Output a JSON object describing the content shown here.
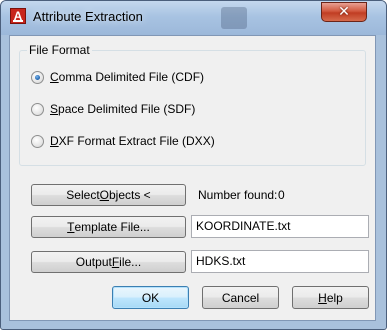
{
  "window": {
    "title": "Attribute Extraction",
    "icon_glyph": "A",
    "close_glyph": "✕"
  },
  "file_format": {
    "label": "File Format",
    "options": [
      {
        "pre": "",
        "key": "C",
        "post": "omma Delimited File (CDF)",
        "selected": true
      },
      {
        "pre": "",
        "key": "S",
        "post": "pace Delimited File (SDF)",
        "selected": false
      },
      {
        "pre": "",
        "key": "D",
        "post": "XF Format Extract File (DXX)",
        "selected": false
      }
    ]
  },
  "select_objects": {
    "pre": "Select ",
    "key": "O",
    "post": "bjects <"
  },
  "number_found": {
    "label": "Number found:",
    "value": "0"
  },
  "template_file": {
    "pre": "",
    "key": "T",
    "post": "emplate File...",
    "value": "KOORDINATE.txt"
  },
  "output_file": {
    "pre": "Output ",
    "key": "F",
    "post": "ile...",
    "value": "HDKS.txt"
  },
  "buttons": {
    "ok": "OK",
    "cancel": "Cancel",
    "help_key": "H",
    "help_post": "elp"
  },
  "colors": {
    "frame": "#a9c1dc",
    "client_bg": "#f0f0f0",
    "close_red": "#c13d23",
    "default_button_border": "#3c7fb1"
  }
}
